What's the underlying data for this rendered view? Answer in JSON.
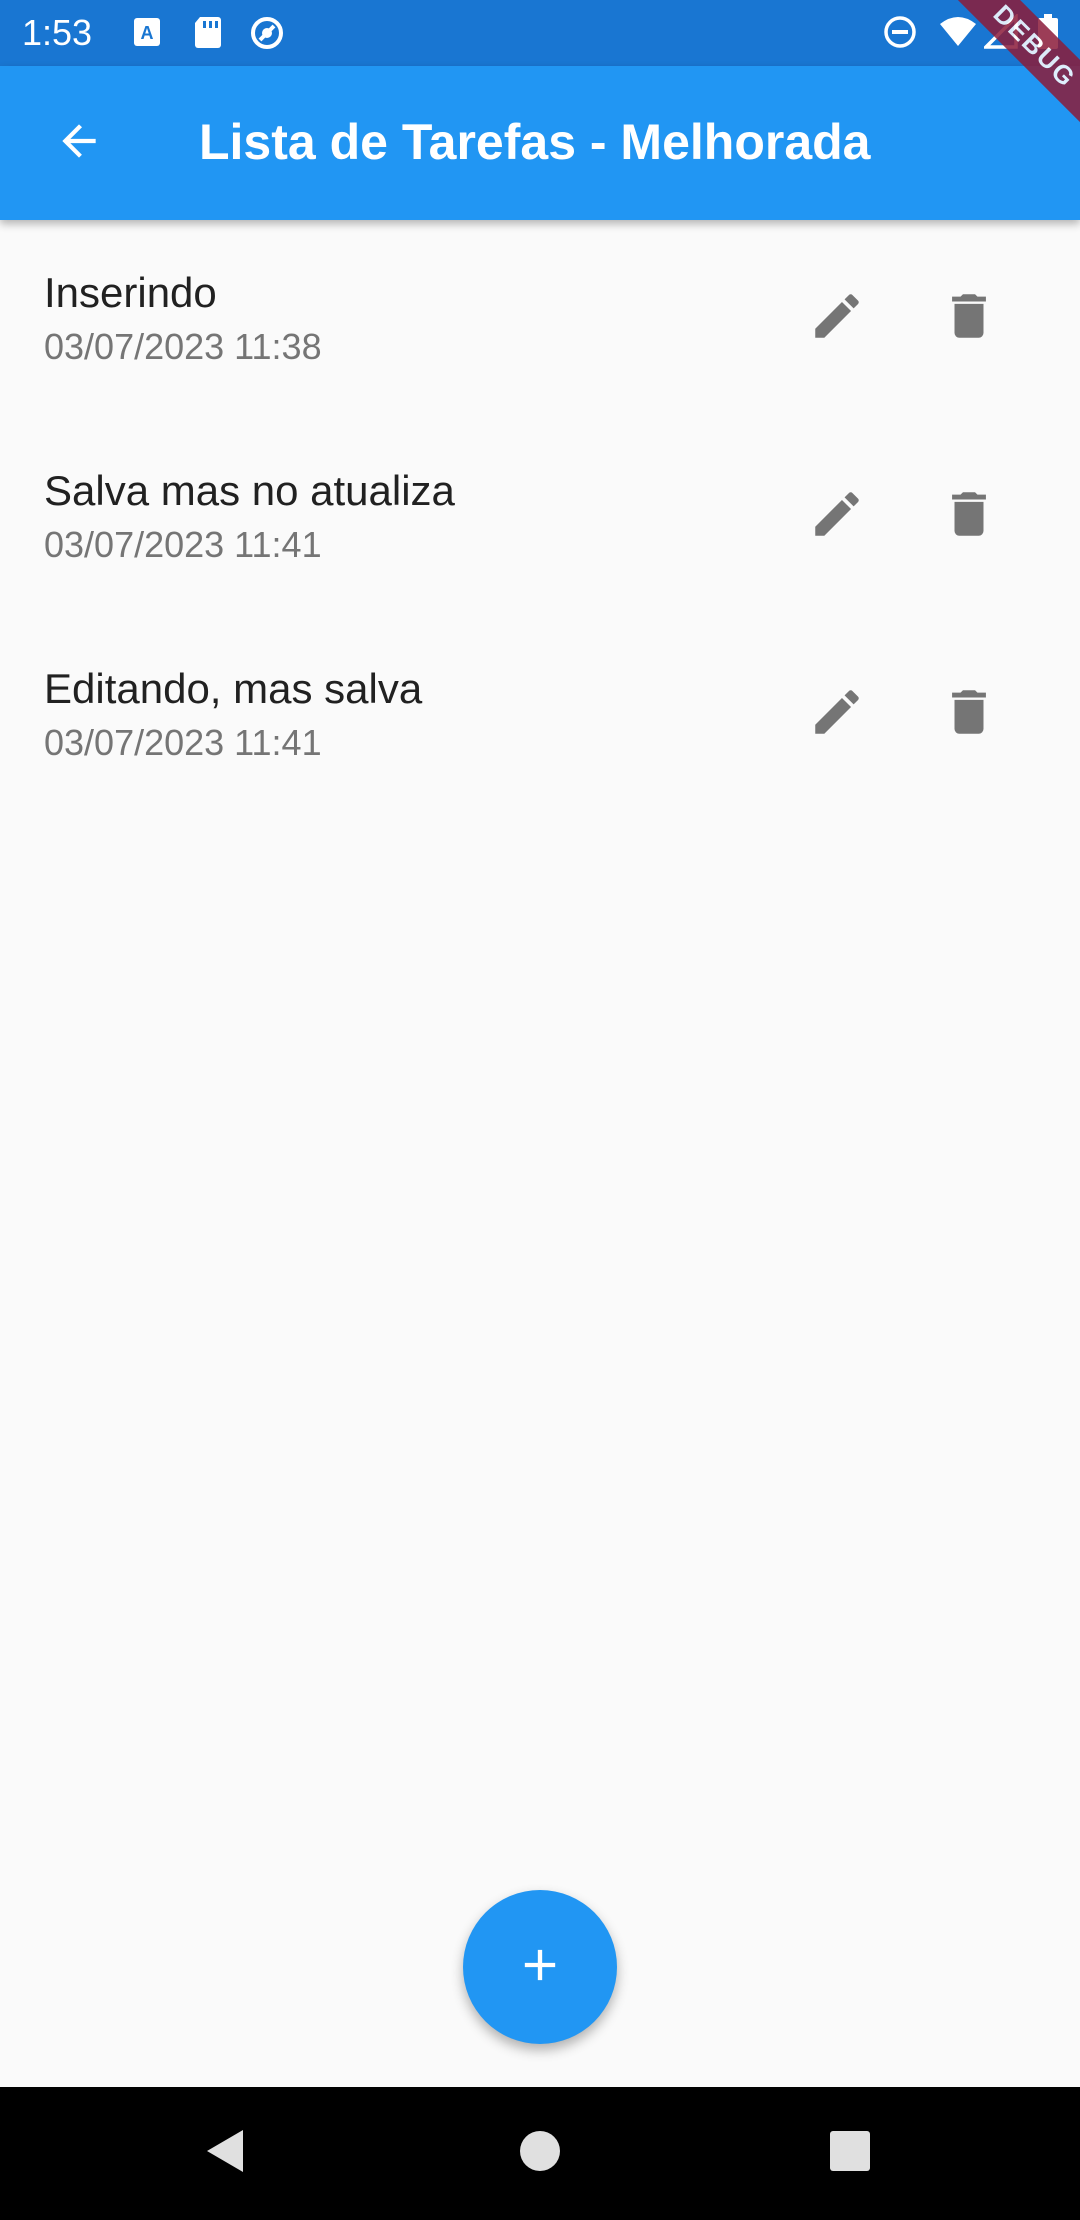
{
  "status_bar": {
    "time": "1:53",
    "icons": [
      "keyboard-a-icon",
      "sd-card-icon",
      "sync-circle-icon",
      "do-not-disturb-icon",
      "wifi-icon",
      "signal-icon",
      "battery-icon"
    ],
    "color": "#1976d2"
  },
  "app_bar": {
    "title": "Lista de Tarefas - Melhorada",
    "back_icon": "arrow-back-icon",
    "color": "#2196f3"
  },
  "debug_banner": {
    "label": "DEBUG"
  },
  "tasks": [
    {
      "title": "Inserindo",
      "date": "03/07/2023 11:38"
    },
    {
      "title": "Salva mas no atualiza",
      "date": "03/07/2023 11:41"
    },
    {
      "title": "Editando, mas salva",
      "date": "03/07/2023 11:41"
    }
  ],
  "row_actions": {
    "edit_icon": "pencil-icon",
    "delete_icon": "trash-icon",
    "icon_color": "#757575"
  },
  "fab": {
    "icon": "plus-icon",
    "color": "#2196f3"
  },
  "nav_bar": {
    "buttons": [
      "back-triangle-icon",
      "home-circle-icon",
      "recents-square-icon"
    ]
  }
}
